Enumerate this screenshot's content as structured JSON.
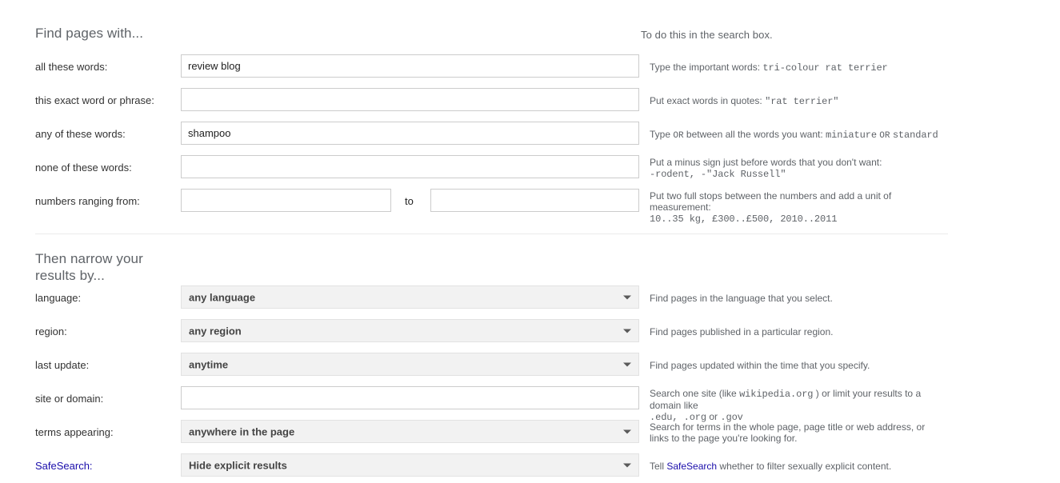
{
  "headings": {
    "find_pages_with": "Find pages with...",
    "to_do_this": "To do this in the search box.",
    "then_narrow": "Then narrow your results by..."
  },
  "separators": {
    "to": "to"
  },
  "find_pages_rows": [
    {
      "label": "all these words:",
      "value": "review blog",
      "placeholder": "",
      "hint_prefix": "Type the important words:",
      "hint_mono": "tri-colour rat terrier",
      "hint_suffix": ""
    },
    {
      "label": "this exact word or phrase:",
      "value": "",
      "placeholder": "",
      "hint_prefix": "Put exact words in quotes:",
      "hint_mono": "\"rat terrier\"",
      "hint_suffix": ""
    },
    {
      "label": "any of these words:",
      "value": "shampoo",
      "placeholder": "",
      "hint_prefix": "Type",
      "hint_smallcaps": "OR",
      "hint_mid": "between all the words you want:",
      "hint_mono": "miniature",
      "hint_smallcaps2": "OR",
      "hint_mono2": "standard"
    },
    {
      "label": "none of these words:",
      "value": "",
      "placeholder": "",
      "hint_prefix": "Put a minus sign just before words that you don't want:",
      "hint_mono": "-rodent, -\"Jack Russell\""
    },
    {
      "label": "numbers ranging from:",
      "value_from": "",
      "value_to": "",
      "placeholder_from": "",
      "placeholder_to": "",
      "hint_prefix": "Put two full stops between the numbers and add a unit of measurement:",
      "hint_mono": "10..35 kg, £300..£500, 2010..2011"
    }
  ],
  "narrow_rows": [
    {
      "label": "language:",
      "type": "select",
      "value": "any language",
      "hint": "Find pages in the language that you select."
    },
    {
      "label": "region:",
      "type": "select",
      "value": "any region",
      "hint": "Find pages published in a particular region."
    },
    {
      "label": "last update:",
      "type": "select",
      "value": "anytime",
      "hint": "Find pages updated within the time that you specify."
    },
    {
      "label": "site or domain:",
      "type": "text",
      "value": "",
      "placeholder": "",
      "hint_a": "Search one site (like",
      "hint_mono_a": "wikipedia.org",
      "hint_b": ") or limit your results to a domain like",
      "hint_mono_b": ".edu, .org",
      "hint_c": "or",
      "hint_mono_c": ".gov"
    },
    {
      "label": "terms appearing:",
      "type": "select",
      "value": "anywhere in the page",
      "hint": "Search for terms in the whole page, page title or web address, or links to the page you're looking for."
    },
    {
      "label": "SafeSearch:",
      "type": "select",
      "value": "Hide explicit results",
      "label_is_link": true,
      "hint_a": "Tell",
      "hint_link": "SafeSearch",
      "hint_b": "whether to filter sexually explicit content."
    }
  ],
  "colors": {
    "link": "#1a0dab",
    "label": "#333333",
    "hint": "#5f6368",
    "select_bg": "#f2f2f2",
    "input_border": "#cccccc",
    "divider": "#ebebeb"
  }
}
